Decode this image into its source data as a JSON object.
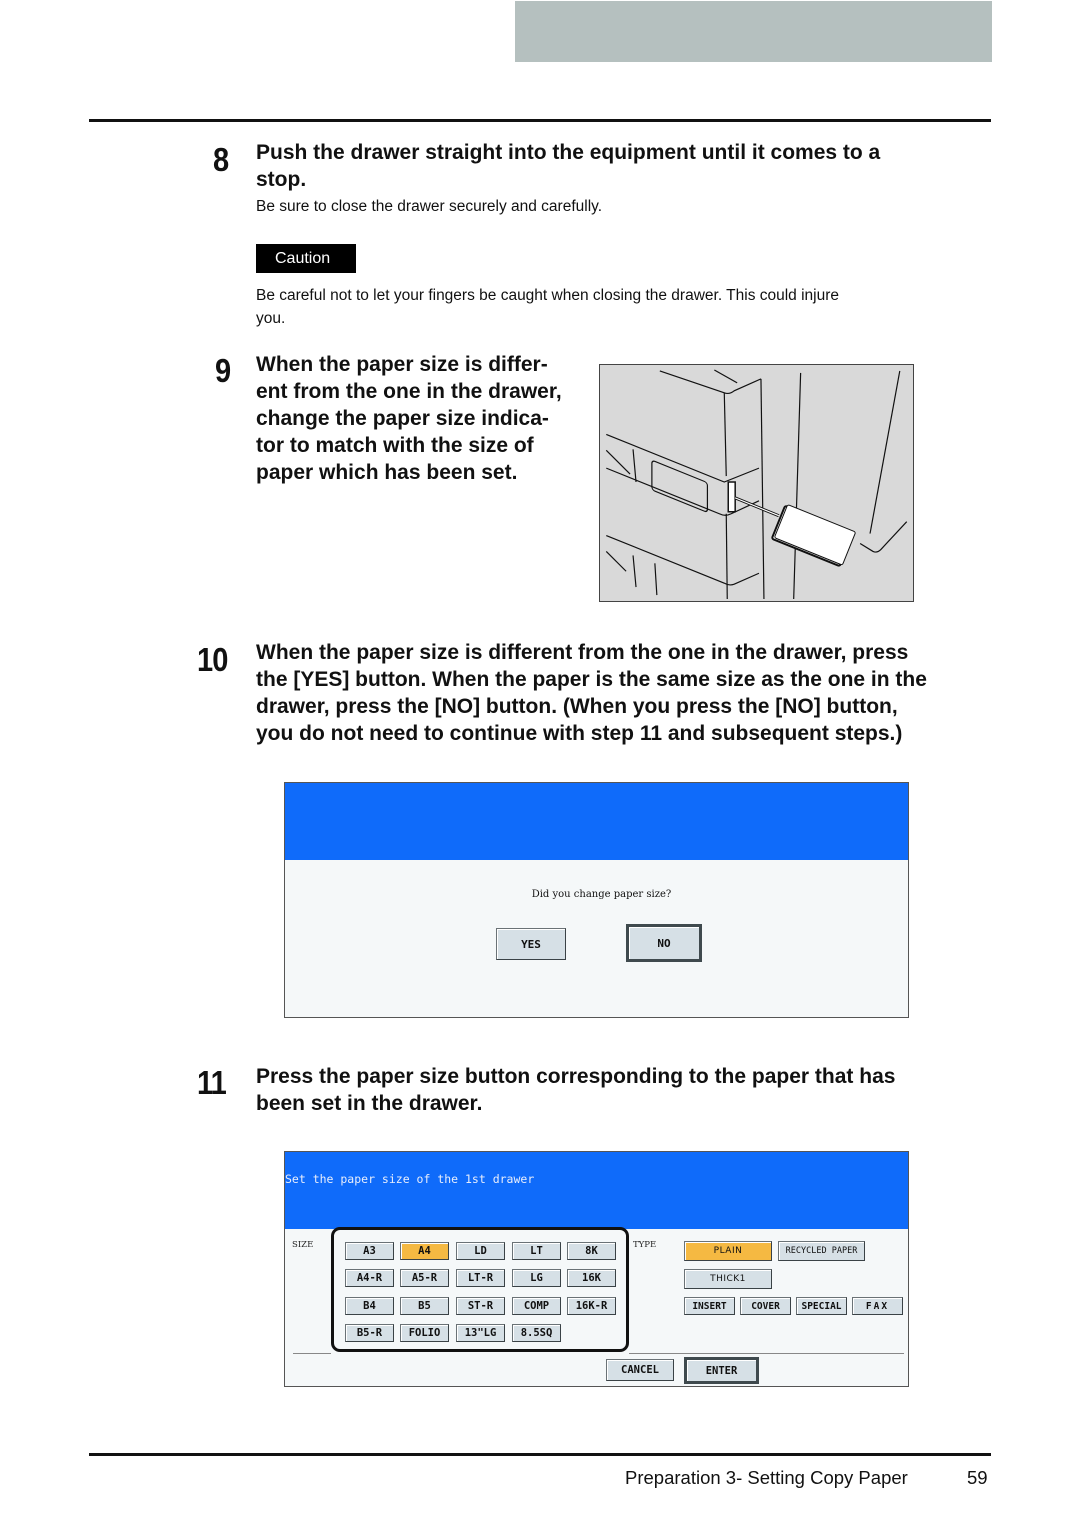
{
  "header": {
    "tab_color": "#b5c0bf"
  },
  "steps": [
    {
      "number": "8",
      "heading_line1": "Push the drawer straight into the equipment until it comes to a",
      "heading_line2": "stop.",
      "body": "Be sure to close the drawer securely and carefully.",
      "caution": {
        "label": "Caution",
        "text_line1": "Be careful not to let your fingers be caught when closing the drawer. This could injure",
        "text_line2": "you."
      }
    },
    {
      "number": "9",
      "heading_lines": [
        "When the paper size is differ-",
        "ent from the one in the drawer,",
        "change the paper size indica-",
        "tor to match with the size of",
        "paper which has been set."
      ],
      "illustration": "paper-size-indicator-drawer-illustration"
    },
    {
      "number": "10",
      "heading_lines": [
        "When the paper size is different from the one in the drawer, press",
        "the [YES] button. When the paper is the same size as the one in the",
        "drawer, press the [NO] button. (When you press the [NO] button,",
        "you do not need to continue with step 11 and subsequent steps.)"
      ],
      "dialog": {
        "message": "Did you change paper size?",
        "yes_label": "YES",
        "no_label": "NO",
        "header_color": "#0f6bfa"
      }
    },
    {
      "number": "11",
      "heading_lines": [
        "Press the paper size button corresponding to the paper that has",
        "been set in the drawer."
      ],
      "dialog": {
        "title": "Set the paper size of the 1st drawer",
        "size_label": "SIZE",
        "type_label": "TYPE",
        "size_buttons": [
          [
            "A3",
            "A4",
            "LD",
            "LT",
            "8K"
          ],
          [
            "A4-R",
            "A5-R",
            "LT-R",
            "LG",
            "16K"
          ],
          [
            "B4",
            "B5",
            "ST-R",
            "COMP",
            "16K-R"
          ],
          [
            "B5-R",
            "FOLIO",
            "13\"LG",
            "8.5SQ"
          ]
        ],
        "selected_size": "A4",
        "type_buttons": {
          "plain": "PLAIN",
          "recycled": "RECYCLED PAPER",
          "thick1": "THICK1",
          "insert": "INSERT",
          "cover": "COVER",
          "special": "SPECIAL",
          "fax": "FAX"
        },
        "selected_type": "PLAIN",
        "cancel_label": "CANCEL",
        "enter_label": "ENTER",
        "selected_color": "#f5b942"
      }
    }
  ],
  "footer": {
    "section": "Preparation 3- Setting Copy Paper",
    "page_number": "59"
  }
}
